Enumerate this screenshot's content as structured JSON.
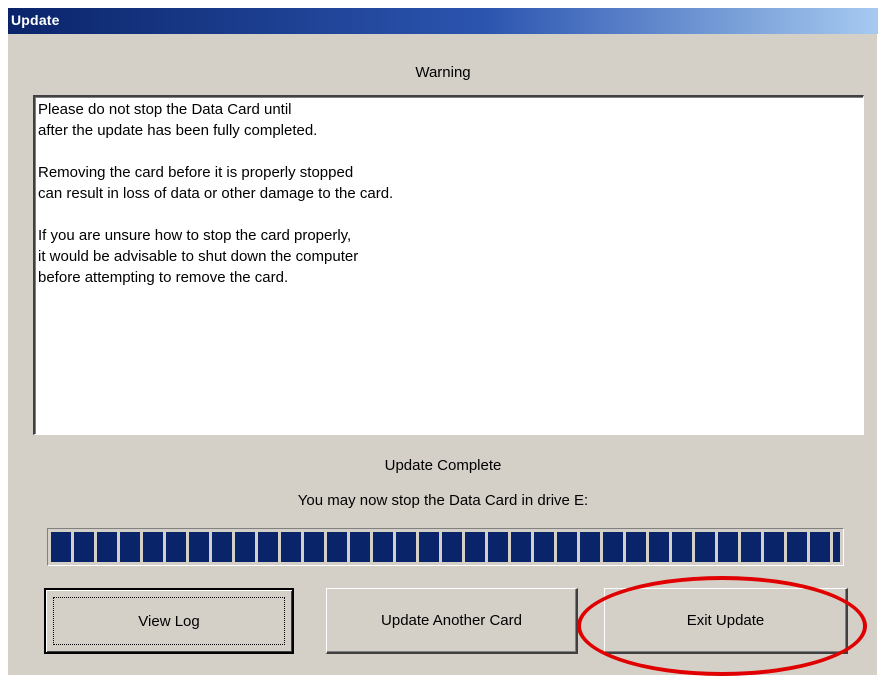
{
  "window": {
    "title": "Update"
  },
  "warning": {
    "heading": "Warning",
    "paragraphs": [
      [
        "Please do not stop the Data Card until",
        "after the update has been fully completed."
      ],
      [
        "Removing the card before it is properly stopped",
        "can result in loss of data or other damage to the card."
      ],
      [
        "If you are unsure how to stop the card properly,",
        "it would be advisable to shut down the computer",
        "before attempting to remove the card."
      ]
    ]
  },
  "status": {
    "heading": "Update Complete",
    "detail": "You may now stop the Data Card in drive E:",
    "progress_fraction": 1.0,
    "progress_color": "#0a246a"
  },
  "buttons": {
    "view_log": "View Log",
    "update_another": "Update Another Card",
    "exit_update": "Exit Update"
  },
  "annotation": {
    "highlight_color": "#e00000",
    "highlight_target": "exit-update-button"
  }
}
